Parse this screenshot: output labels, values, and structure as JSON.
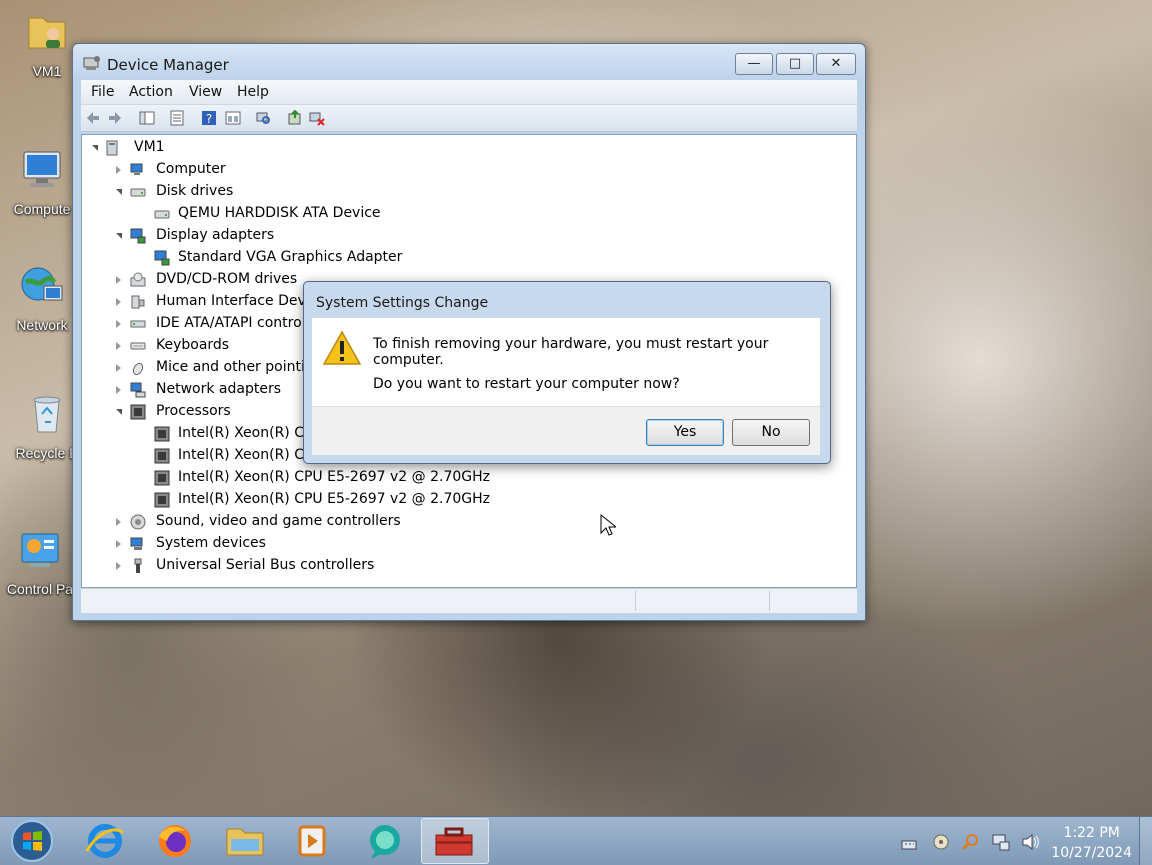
{
  "desktop": {
    "icons": [
      {
        "label": "VM1"
      },
      {
        "label": "Compute"
      },
      {
        "label": "Network"
      },
      {
        "label": "Recycle B"
      },
      {
        "label": "Control Pa"
      }
    ]
  },
  "window": {
    "title": "Device Manager",
    "controls": {
      "minimize": "—",
      "maximize": "□",
      "close": "✕"
    },
    "menu": [
      "File",
      "Action",
      "View",
      "Help"
    ],
    "tree": {
      "root": "VM1",
      "nodes": [
        {
          "label": "Computer",
          "expanded": false
        },
        {
          "label": "Disk drives",
          "expanded": true,
          "children": [
            "QEMU HARDDISK ATA Device"
          ]
        },
        {
          "label": "Display adapters",
          "expanded": true,
          "children": [
            "Standard VGA Graphics Adapter"
          ]
        },
        {
          "label": "DVD/CD-ROM drives",
          "expanded": false
        },
        {
          "label": "Human Interface Devic",
          "expanded": false
        },
        {
          "label": "IDE ATA/ATAPI contro",
          "expanded": false
        },
        {
          "label": "Keyboards",
          "expanded": false
        },
        {
          "label": "Mice and other pointin",
          "expanded": false
        },
        {
          "label": "Network adapters",
          "expanded": false
        },
        {
          "label": "Processors",
          "expanded": true,
          "children": [
            "Intel(R) Xeon(R) CP",
            "Intel(R) Xeon(R) CP",
            "Intel(R) Xeon(R) CPU E5-2697 v2 @ 2.70GHz",
            "Intel(R) Xeon(R) CPU E5-2697 v2 @ 2.70GHz"
          ]
        },
        {
          "label": "Sound, video and game controllers",
          "expanded": false
        },
        {
          "label": "System devices",
          "expanded": false
        },
        {
          "label": "Universal Serial Bus controllers",
          "expanded": false
        }
      ]
    }
  },
  "dialog": {
    "title": "System Settings Change",
    "message": "To finish removing your hardware, you must restart your computer.",
    "question": "Do you want to restart your computer now?",
    "yes": "Yes",
    "no": "No"
  },
  "taskbar": {
    "time": "1:22 PM",
    "date": "10/27/2024"
  },
  "colors": {
    "accent": "#3c7fb1",
    "warning": "#f5c21b"
  }
}
